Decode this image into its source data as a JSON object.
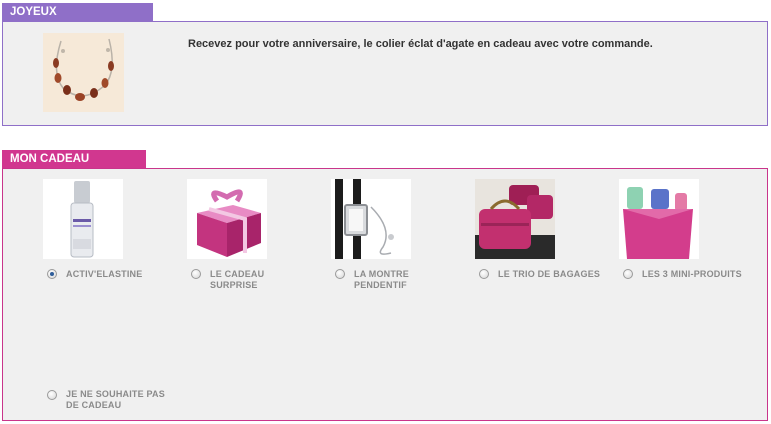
{
  "anniversary": {
    "tab_label": "JOYEUX ANNIVERSAIRE",
    "message": "Recevez pour votre anniversaire, le colier éclat d'agate en cadeau avec votre commande.",
    "image_icon": "agate-necklace-image"
  },
  "gift": {
    "tab_label": "MON CADEAU BEAUTÉ",
    "options": [
      {
        "line1": "ACTIV'ELASTINE",
        "line2": "",
        "selected": true,
        "image_icon": "serum-bottle-image"
      },
      {
        "line1": "LE CADEAU",
        "line2": "SURPRISE",
        "selected": false,
        "image_icon": "gift-box-image"
      },
      {
        "line1": "LA MONTRE",
        "line2": "PENDENTIF",
        "selected": false,
        "image_icon": "watch-image"
      },
      {
        "line1": "LE TRIO DE BAGAGES",
        "line2": "",
        "selected": false,
        "image_icon": "luggage-image"
      },
      {
        "line1": "LES 3 MINI-PRODUITS",
        "line2": "",
        "selected": false,
        "image_icon": "mini-products-image"
      },
      {
        "line1": "JE NE SOUHAITE PAS",
        "line2": "DE CADEAU",
        "selected": false,
        "image_icon": ""
      }
    ]
  },
  "colors": {
    "anniversary_accent": "#8f6fc8",
    "gift_accent": "#d1378f",
    "panel_bg": "#f0f0f0"
  }
}
